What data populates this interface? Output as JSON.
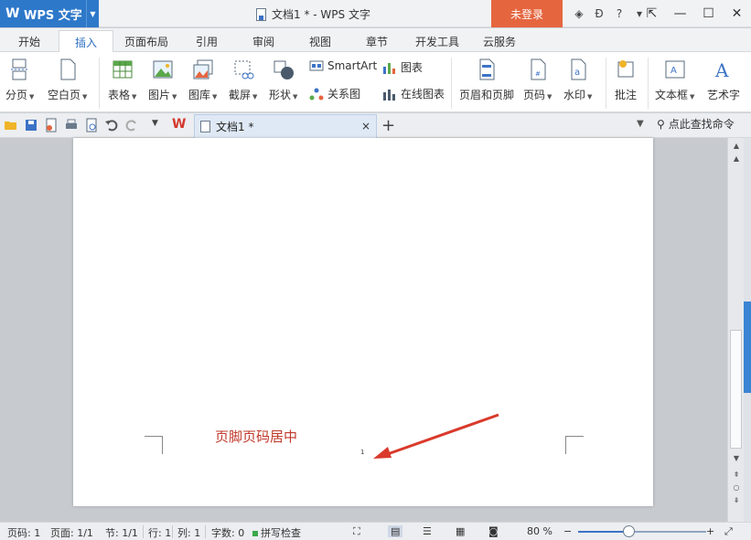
{
  "app": {
    "name": "WPS 文字"
  },
  "window": {
    "title": "文档1 * - WPS 文字",
    "login_label": "未登录"
  },
  "menu_tabs": [
    "开始",
    "插入",
    "页面布局",
    "引用",
    "审阅",
    "视图",
    "章节",
    "开发工具",
    "云服务"
  ],
  "ribbon": {
    "page_break": "分页",
    "blank_page": "空白页",
    "table": "表格",
    "picture": "图片",
    "gallery": "图库",
    "screenshot": "截屏",
    "shapes": "形状",
    "smartart": "SmartArt",
    "chart": "图表",
    "relation": "关系图",
    "online_chart": "在线图表",
    "header_footer": "页眉和页脚",
    "page_number": "页码",
    "watermark": "水印",
    "comment": "批注",
    "textbox": "文本框",
    "wordart": "艺术字"
  },
  "doc_tab": {
    "name": "文档1 *",
    "close": "×",
    "new": "+"
  },
  "search": {
    "label": "点此查找命令"
  },
  "document": {
    "annotation": "页脚页码居中",
    "page_number": "1"
  },
  "status": {
    "page": "页码: 1",
    "pages": "页面: 1/1",
    "section": "节: 1/1",
    "row": "行: 1",
    "col": "列: 1",
    "words": "字数: 0",
    "spell": "拼写检查",
    "zoom": "80 %",
    "zoom_level": 0.4
  },
  "colors": {
    "app_blue": "#2d78c9",
    "login_orange": "#e5653f",
    "annotation_red": "#c0392b"
  }
}
